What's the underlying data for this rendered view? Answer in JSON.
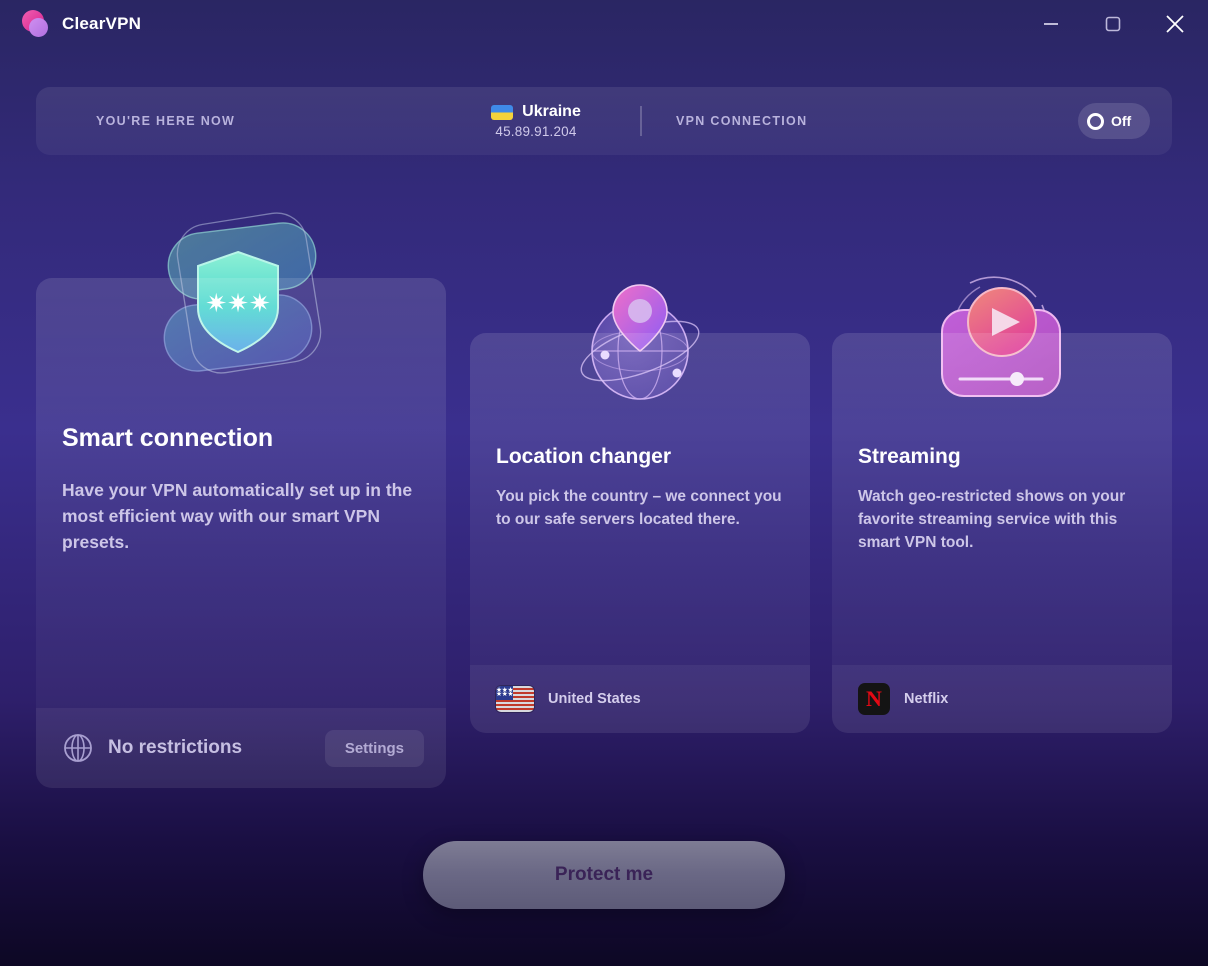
{
  "window": {
    "app_title": "ClearVPN",
    "logo_icon": "clearvpn-logo",
    "minimize_icon": "minimize-icon",
    "maximize_icon": "maximize-icon",
    "close_icon": "close-icon"
  },
  "statusbar": {
    "here_label": "YOU'RE HERE NOW",
    "country": "Ukraine",
    "country_flag_icon": "ukraine-flag-icon",
    "ip_address": "45.89.91.204",
    "vpn_label": "VPN CONNECTION",
    "toggle_state": "Off"
  },
  "cards": [
    {
      "id": "smart-connection",
      "title": "Smart connection",
      "description": "Have your VPN automatically set up in the most efficient way with our smart VPN presets.",
      "illustration_icon": "shield-password-icon",
      "footer_icon": "globe-icon",
      "footer_text": "No restrictions",
      "action_label": "Settings"
    },
    {
      "id": "location-changer",
      "title": "Location changer",
      "description": "You pick the country – we connect you to our safe servers located there.",
      "illustration_icon": "globe-pin-icon",
      "footer_icon": "united-states-flag-icon",
      "footer_text": "United States"
    },
    {
      "id": "streaming",
      "title": "Streaming",
      "description": "Watch geo-restricted shows on your favorite streaming service with this smart VPN tool.",
      "illustration_icon": "video-player-icon",
      "footer_icon": "netflix-icon",
      "footer_text": "Netflix",
      "footer_logo_glyph": "N"
    }
  ],
  "footer": {
    "protect_label": "Protect me"
  },
  "colors": {
    "brand_pink": "#e0399c",
    "accent_purple": "#8b5cf6",
    "netflix_red": "#e50914",
    "background_top": "#2a2663",
    "background_bottom": "#0d0724"
  }
}
